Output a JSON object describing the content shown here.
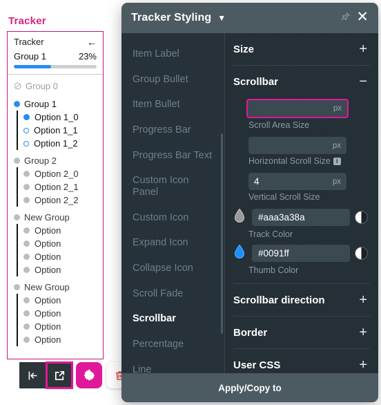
{
  "tracker": {
    "section_title": "Tracker",
    "header_label": "Tracker",
    "back_icon": "arrow-left-icon",
    "group_label": "Group 1",
    "percent_label": "23%",
    "progress_value": 45,
    "groups": [
      {
        "label": "Group 0",
        "bullet": "disabled-circle-icon",
        "state": "disabled",
        "items": []
      },
      {
        "label": "Group 1",
        "bullet": "filled-blue-dot",
        "state": "active",
        "items": [
          {
            "label": "Option 1_0",
            "bullet": "filled-blue-dot"
          },
          {
            "label": "Option 1_1",
            "bullet": "hollow-blue-dot"
          },
          {
            "label": "Option 1_2",
            "bullet": "hollow-blue-dot"
          }
        ]
      },
      {
        "label": "Group 2",
        "bullet": "filled-gray-dot",
        "state": "normal",
        "items": [
          {
            "label": "Option 2_0",
            "bullet": "filled-gray-dot"
          },
          {
            "label": "Option 2_1",
            "bullet": "filled-gray-dot"
          },
          {
            "label": "Option 2_2",
            "bullet": "filled-gray-dot"
          }
        ]
      },
      {
        "label": "New Group",
        "bullet": "filled-gray-dot",
        "state": "normal",
        "items": [
          {
            "label": "Option",
            "bullet": "filled-gray-dot"
          },
          {
            "label": "Option",
            "bullet": "filled-gray-dot"
          },
          {
            "label": "Option",
            "bullet": "filled-gray-dot"
          },
          {
            "label": "Option",
            "bullet": "filled-gray-dot"
          }
        ]
      },
      {
        "label": "New Group",
        "bullet": "filled-gray-dot",
        "state": "normal",
        "items": [
          {
            "label": "Option",
            "bullet": "filled-gray-dot"
          },
          {
            "label": "Option",
            "bullet": "filled-gray-dot"
          },
          {
            "label": "Option",
            "bullet": "filled-gray-dot"
          },
          {
            "label": "Option",
            "bullet": "filled-gray-dot"
          }
        ]
      }
    ],
    "toolbar": [
      {
        "icon": "collapse-left-icon",
        "state": "normal"
      },
      {
        "icon": "open-external-icon",
        "state": "selected"
      },
      {
        "icon": "gear-icon",
        "state": "accent"
      },
      {
        "icon": "trash-icon",
        "state": "light"
      }
    ]
  },
  "panel": {
    "title": "Tracker Styling",
    "title_chevron_icon": "chevron-down-icon",
    "pin_icon": "pin-icon",
    "close_icon": "close-icon",
    "nav_items": [
      {
        "label": "Item Label",
        "active": false
      },
      {
        "label": "Group Bullet",
        "active": false
      },
      {
        "label": "Item Bullet",
        "active": false
      },
      {
        "label": "Progress Bar",
        "active": false
      },
      {
        "label": "Progress Bar Text",
        "active": false
      },
      {
        "label": "Custom Icon Panel",
        "active": false
      },
      {
        "label": "Custom Icon",
        "active": false
      },
      {
        "label": "Expand Icon",
        "active": false
      },
      {
        "label": "Collapse Icon",
        "active": false
      },
      {
        "label": "Scroll Fade",
        "active": false
      },
      {
        "label": "Scrollbar",
        "active": true
      },
      {
        "label": "Percentage",
        "active": false
      },
      {
        "label": "Line",
        "active": false
      }
    ],
    "sections": [
      {
        "title": "Size",
        "toggle": "+",
        "expanded": false
      },
      {
        "title": "Scrollbar",
        "toggle": "−",
        "expanded": true
      },
      {
        "title": "Scrollbar direction",
        "toggle": "+",
        "expanded": false
      },
      {
        "title": "Border",
        "toggle": "+",
        "expanded": false
      },
      {
        "title": "User CSS",
        "toggle": "+",
        "expanded": false
      }
    ],
    "scrollbar_fields": [
      {
        "value": "",
        "unit": "px",
        "label": "Scroll Area Size",
        "focused": true,
        "info": false
      },
      {
        "value": "",
        "unit": "px",
        "label": "Horizontal Scroll Size",
        "focused": false,
        "info": true
      },
      {
        "value": "4",
        "unit": "px",
        "label": "Vertical Scroll Size",
        "focused": false,
        "info": false
      }
    ],
    "color_fields": [
      {
        "value": "#aaa3a38a",
        "label": "Track Color",
        "swatch": "#9a9a9a",
        "droplet_icon": "droplet-icon",
        "contrast_icon": "contrast-icon"
      },
      {
        "value": "#0091ff",
        "label": "Thumb Color",
        "swatch": "#0091ff",
        "droplet_icon": "droplet-icon",
        "contrast_icon": "contrast-icon"
      }
    ],
    "apply_label": "Apply/Copy to"
  },
  "colors": {
    "accent_magenta": "#e0189a",
    "tracker_border": "#c2187f",
    "progress_blue": "#2b8cf0",
    "panel_bg": "#252f36",
    "panel_header": "#4c5a61"
  }
}
